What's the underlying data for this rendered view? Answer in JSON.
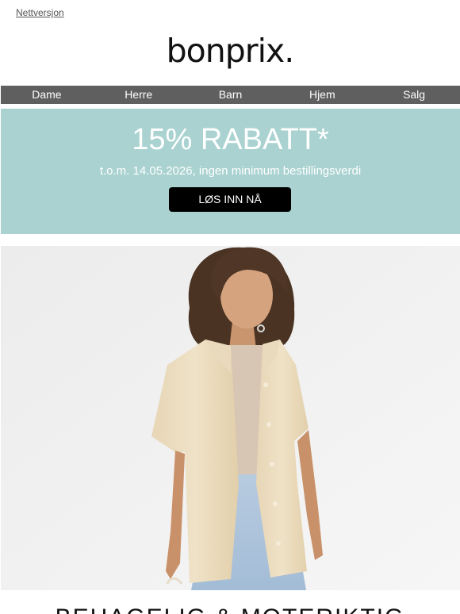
{
  "header": {
    "web_version_link": "Nettversjon",
    "logo_text": "bonprix."
  },
  "nav": {
    "items": [
      "Dame",
      "Herre",
      "Barn",
      "Hjem",
      "Salg"
    ]
  },
  "promo": {
    "title": "15% RABATT*",
    "subtitle": "t.o.m. 14.05.2026, ingen minimum bestillingsverdi",
    "button_label": "LØS INN NÅ",
    "background_color": "#a9d2d0"
  },
  "hero": {
    "image_icon": "model-in-beige-shirt-photo"
  },
  "headline": {
    "text": "BEHAGELIG & MOTERIKTIG"
  }
}
